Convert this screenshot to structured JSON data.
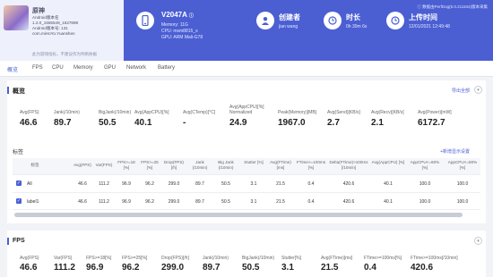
{
  "app": {
    "name": "原神",
    "lines": [
      "Android版本名",
      "1.2.0_1565549_1627898",
      "Android版本号: 131",
      "com.miHoYo.Yuanshen"
    ],
    "note": "此为游戏指标，不建议作为判断依据"
  },
  "device": {
    "title": "V2047A",
    "memory": "Memory: 11G",
    "cpu": "CPU: msm8815_s",
    "gpu": "GPU: ARM Mali-G78"
  },
  "creator": {
    "title": "创建者",
    "value": "jian wang"
  },
  "duration": {
    "title": "时长",
    "value": "0h 30m 6s"
  },
  "upload": {
    "title": "上传时间",
    "value": "12/01/2021 12:49:48"
  },
  "version_note": "数据由PerfDog(5.0.211104)版本采集",
  "tabs": [
    "概览",
    "FPS",
    "CPU",
    "Memory",
    "GPU",
    "Network",
    "Battery"
  ],
  "overview": {
    "title": "概览",
    "export": "导出全部",
    "metrics": [
      {
        "label": "Avg(FPS)",
        "value": "46.6"
      },
      {
        "label": "Jank(/10min)",
        "value": "89.7"
      },
      {
        "label": "BigJank(/10min)",
        "value": "50.5"
      },
      {
        "label": "Avg(AppCPU)[%]",
        "value": "40.1"
      },
      {
        "label": "Avg(CTemp)[°C]",
        "value": "-"
      },
      {
        "label": "Avg(AppCPU)[%] Normalized",
        "value": "24.9"
      },
      {
        "label": "Peak(Memory)[MB]",
        "value": "1967.0"
      },
      {
        "label": "Avg(Send)[KB/s]",
        "value": "2.7"
      },
      {
        "label": "Avg(Recv)[KB/s]",
        "value": "2.1"
      },
      {
        "label": "Avg(Power)[mW]",
        "value": "6172.7"
      }
    ]
  },
  "labels": {
    "title": "标签",
    "add_link": "+新增显示设置",
    "headers": [
      "标签",
      "Avg(FPS)",
      "Var(FPS)",
      "FPS>=18 [%]",
      "FPS>=25 [%]",
      "Drop(FPS) [/h]",
      "Jank (/10min)",
      "Big Jank (/10min)",
      "Stutter [%]",
      "Avg(FTime) [ms]",
      "FTime>=100ms [%]",
      "Delta(FTime)>100ms [/10min]",
      "Avg(AppCPU) [%]",
      "AppCPU<=60% [%]",
      "AppCPU<=80% [%]"
    ],
    "rows": [
      [
        "All",
        "46.6",
        "111.2",
        "96.9",
        "96.2",
        "299.0",
        "89.7",
        "50.5",
        "3.1",
        "21.5",
        "0.4",
        "420.6",
        "40.1",
        "100.0",
        "100.0"
      ],
      [
        "label1",
        "46.6",
        "111.2",
        "96.9",
        "96.2",
        "299.0",
        "89.7",
        "50.5",
        "3.1",
        "21.5",
        "0.4",
        "420.6",
        "40.1",
        "100.0",
        "100.0"
      ]
    ]
  },
  "fps": {
    "title": "FPS",
    "metrics": [
      {
        "label": "Avg(FPS)",
        "value": "46.6"
      },
      {
        "label": "Var(FPS)",
        "value": "111.2"
      },
      {
        "label": "FPS>=18[%]",
        "value": "96.9"
      },
      {
        "label": "FPS>=25[%]",
        "value": "96.2"
      },
      {
        "label": "Drop(FPS)[/h]",
        "value": "299.0"
      },
      {
        "label": "Jank(/10min)",
        "value": "89.7"
      },
      {
        "label": "BigJank(/10min)",
        "value": "50.5"
      },
      {
        "label": "Stutter[%]",
        "value": "3.1"
      },
      {
        "label": "Avg(FTime)[ms]",
        "value": "21.5"
      },
      {
        "label": "FTime>=100ms[%]",
        "value": "0.4"
      },
      {
        "label": "FTime>=100ms[/10min]",
        "value": "420.6"
      }
    ]
  },
  "colors": {
    "accent": "#4b5fd3",
    "header_bg": "#4b5fd3"
  }
}
